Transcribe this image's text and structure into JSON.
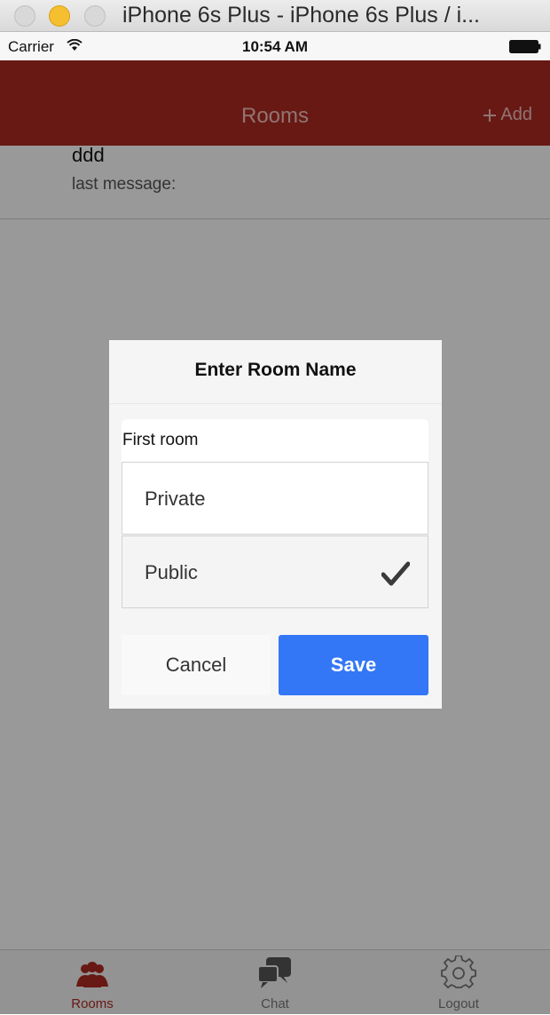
{
  "window": {
    "title": "iPhone 6s Plus - iPhone 6s Plus / i..."
  },
  "status_bar": {
    "carrier": "Carrier",
    "time": "10:54 AM"
  },
  "navbar": {
    "title": "Rooms",
    "add_label": "Add",
    "color": "#ae2a22"
  },
  "rooms": [
    {
      "name": "ddd",
      "last_message": "last message:"
    }
  ],
  "dialog": {
    "title": "Enter Room Name",
    "room_name_value": "First room",
    "options": [
      {
        "label": "Private",
        "selected": false
      },
      {
        "label": "Public",
        "selected": true
      }
    ],
    "cancel_label": "Cancel",
    "save_label": "Save",
    "save_color": "#3377f6"
  },
  "tabs": [
    {
      "label": "Rooms",
      "icon": "users-icon",
      "active": true
    },
    {
      "label": "Chat",
      "icon": "chat-bubbles-icon",
      "active": false
    },
    {
      "label": "Logout",
      "icon": "gear-icon",
      "active": false
    }
  ]
}
